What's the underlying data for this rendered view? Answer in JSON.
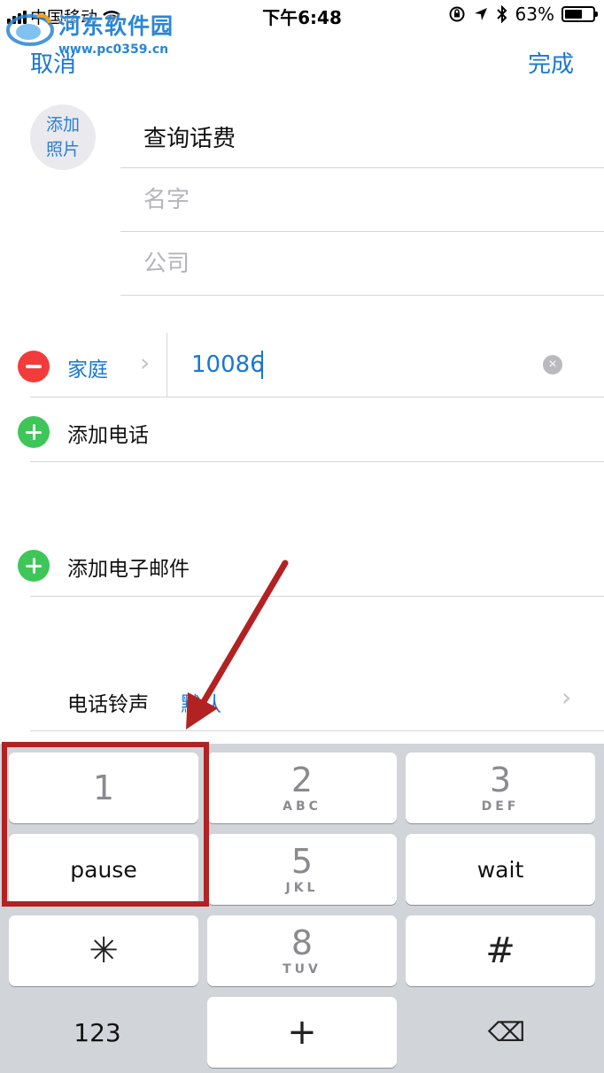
{
  "status_bar": {
    "carrier": "中国移动",
    "time": "下午6:48",
    "battery_percent": "63%",
    "battery_level": 0.63,
    "icons": [
      "signal-icon",
      "wifi-icon",
      "rotation-lock-icon",
      "location-icon",
      "bluetooth-icon",
      "battery-icon"
    ]
  },
  "watermark": {
    "title": "河东软件园",
    "url": "www.pc0359.cn"
  },
  "nav": {
    "cancel_label": "取消",
    "done_label": "完成"
  },
  "photo": {
    "line1": "添加",
    "line2": "照片"
  },
  "name_fields": [
    {
      "value": "查询话费",
      "placeholder": ""
    },
    {
      "value": "",
      "placeholder": "名字"
    },
    {
      "value": "",
      "placeholder": "公司"
    }
  ],
  "phone": {
    "label": "家庭",
    "number": "10086"
  },
  "add_phone_label": "添加电话",
  "add_email_label": "添加电子邮件",
  "ringtone": {
    "label": "电话铃声",
    "value": "默认"
  },
  "keyboard": {
    "keys": [
      {
        "digit": "1",
        "letters": ""
      },
      {
        "digit": "2",
        "letters": "ABC"
      },
      {
        "digit": "3",
        "letters": "DEF"
      },
      {
        "word": "pause"
      },
      {
        "digit": "5",
        "letters": "JKL"
      },
      {
        "word": "wait"
      },
      {
        "symbol": "✳"
      },
      {
        "digit": "8",
        "letters": "TUV"
      },
      {
        "symbol": "#"
      },
      {
        "word": "123"
      },
      {
        "symbol": "+"
      },
      {
        "symbol": "⌫"
      }
    ]
  },
  "colors": {
    "accent": "#1a76d2",
    "delete_red": "#f23b3b",
    "add_green": "#3ec658",
    "annotation_red": "#b22222",
    "keyboard_bg": "#d1d4d9"
  }
}
